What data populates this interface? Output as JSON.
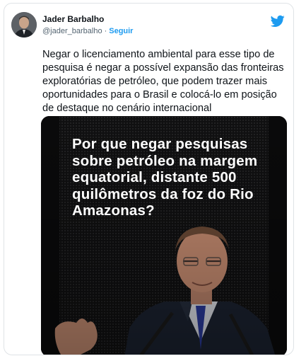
{
  "tweet": {
    "author_name": "Jader Barbalho",
    "handle": "@jader_barbalho",
    "separator": "·",
    "follow_label": "Seguir",
    "text": "Negar o licenciamento ambiental para esse tipo de pesquisa é negar a possível expansão das fronteiras exploratórias de petróleo, que podem trazer mais oportunidades para o Brasil e colocá-lo em posição de destaque no cenário internacional"
  },
  "media": {
    "headline": "Por que negar pesquisas sobre petróleo na margem equatorial, distante 500 quilômetros da foz do Rio Amazonas?"
  },
  "icons": {
    "brand": "twitter-bird-icon"
  },
  "colors": {
    "accent": "#1d9bf0",
    "text": "#0f1419",
    "secondary": "#536471"
  }
}
